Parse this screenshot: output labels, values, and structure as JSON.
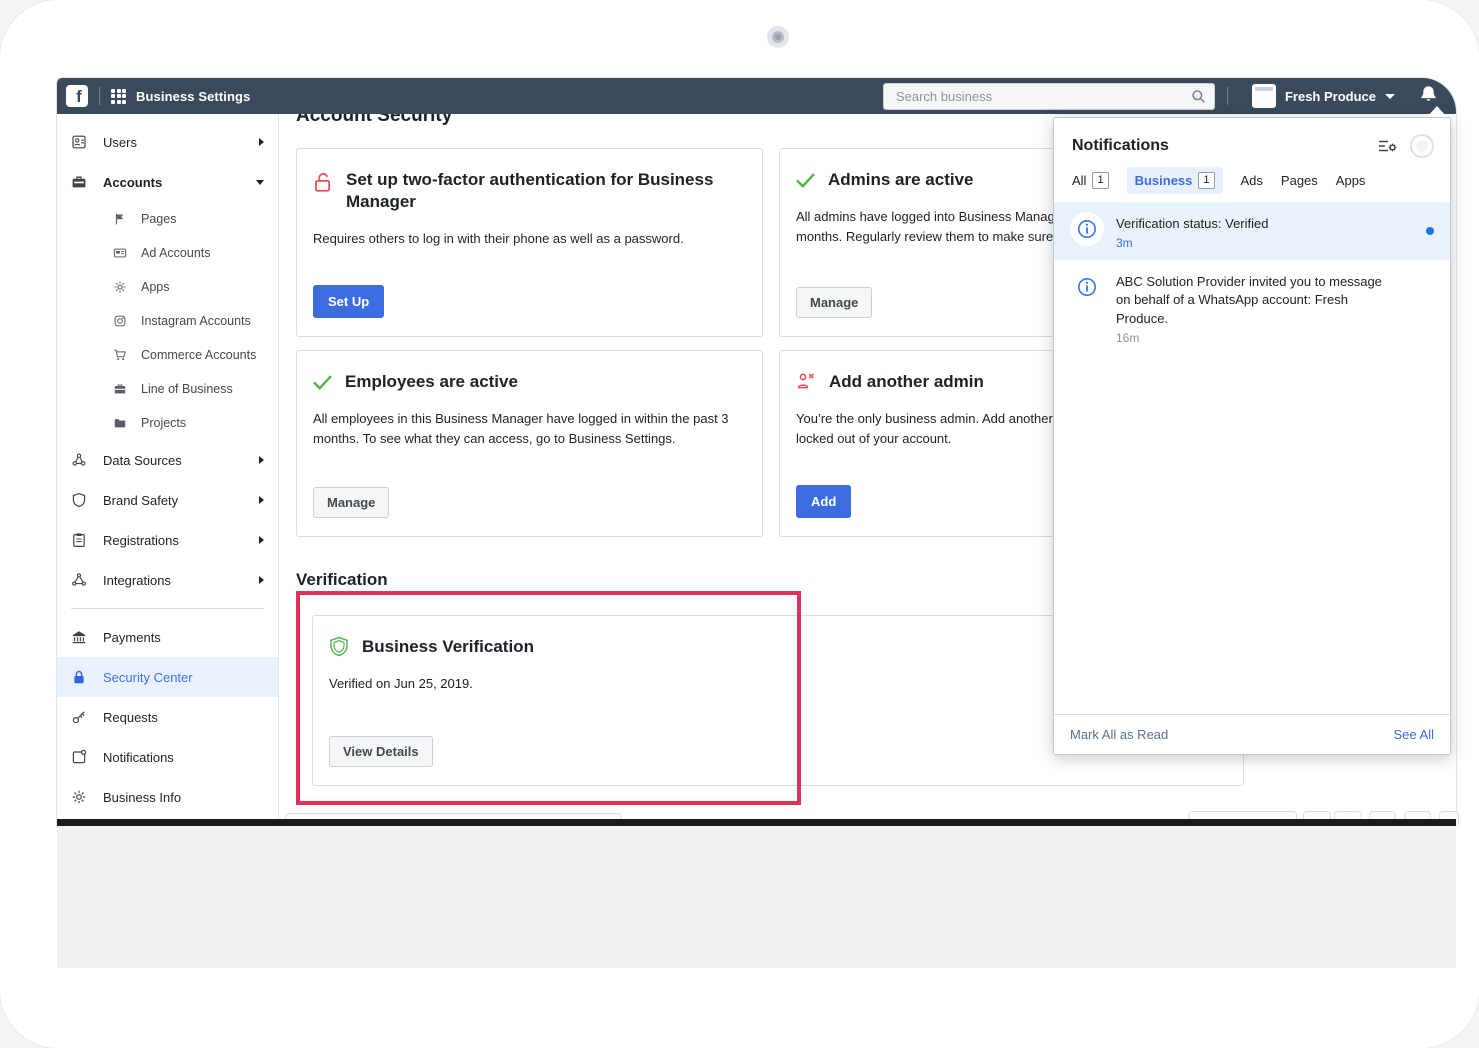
{
  "topbar": {
    "app_title": "Business Settings",
    "search_placeholder": "Search business",
    "business_name": "Fresh Produce"
  },
  "sidebar": {
    "items": [
      {
        "label": "Users"
      },
      {
        "label": "Accounts"
      },
      {
        "label": "Pages"
      },
      {
        "label": "Ad Accounts"
      },
      {
        "label": "Apps"
      },
      {
        "label": "Instagram Accounts"
      },
      {
        "label": "Commerce Accounts"
      },
      {
        "label": "Line of Business"
      },
      {
        "label": "Projects"
      },
      {
        "label": "Data Sources"
      },
      {
        "label": "Brand Safety"
      },
      {
        "label": "Registrations"
      },
      {
        "label": "Integrations"
      },
      {
        "label": "Payments"
      },
      {
        "label": "Security Center"
      },
      {
        "label": "Requests"
      },
      {
        "label": "Notifications"
      },
      {
        "label": "Business Info"
      }
    ]
  },
  "main": {
    "section_account_security": "Account Security",
    "card_two_factor": {
      "title": "Set up two-factor authentication for Business Manager",
      "body": "Requires others to log in with their phone as well as a password.",
      "button": "Set Up"
    },
    "card_admins": {
      "title": "Admins are active",
      "body_line1": "All admins have logged into Business Manager",
      "body_line2": "months. Regularly review them to make sure th",
      "button": "Manage"
    },
    "card_employees": {
      "title": "Employees are active",
      "body": "All employees in this Business Manager have logged in within the past 3 months. To see what they can access, go to Business Settings.",
      "button": "Manage"
    },
    "card_add_admin": {
      "title": "Add another admin",
      "body_line1": "You’re the only business admin. Add another a",
      "body_line2": "locked out of your account.",
      "button": "Add"
    },
    "section_verification": "Verification",
    "card_business_verification": {
      "title": "Business Verification",
      "body": "Verified on Jun 25, 2019.",
      "button": "View Details"
    }
  },
  "notifications_panel": {
    "title": "Notifications",
    "tabs": [
      {
        "label": "All",
        "count": "1"
      },
      {
        "label": "Business",
        "count": "1",
        "active": true
      },
      {
        "label": "Ads"
      },
      {
        "label": "Pages"
      },
      {
        "label": "Apps"
      }
    ],
    "items": [
      {
        "title": "Verification status: Verified",
        "time": "3m",
        "unread": true
      },
      {
        "title": "ABC Solution Provider invited you to message on behalf of a WhatsApp account: Fresh Produce.",
        "time": "16m",
        "unread": false
      }
    ],
    "mark_all_read": "Mark All as Read",
    "see_all": "See All"
  },
  "colors": {
    "topbar_bg": "#3a4a5c",
    "accent_blue": "#3b6ce0",
    "selected_item_bg": "#e9f2fc",
    "unread_row_bg": "#e9f1fb",
    "success_green": "#4fb83e",
    "alert_red": "#ef4b56",
    "annotation_red": "#e0315a",
    "unread_dot_blue": "#1b74e4"
  }
}
